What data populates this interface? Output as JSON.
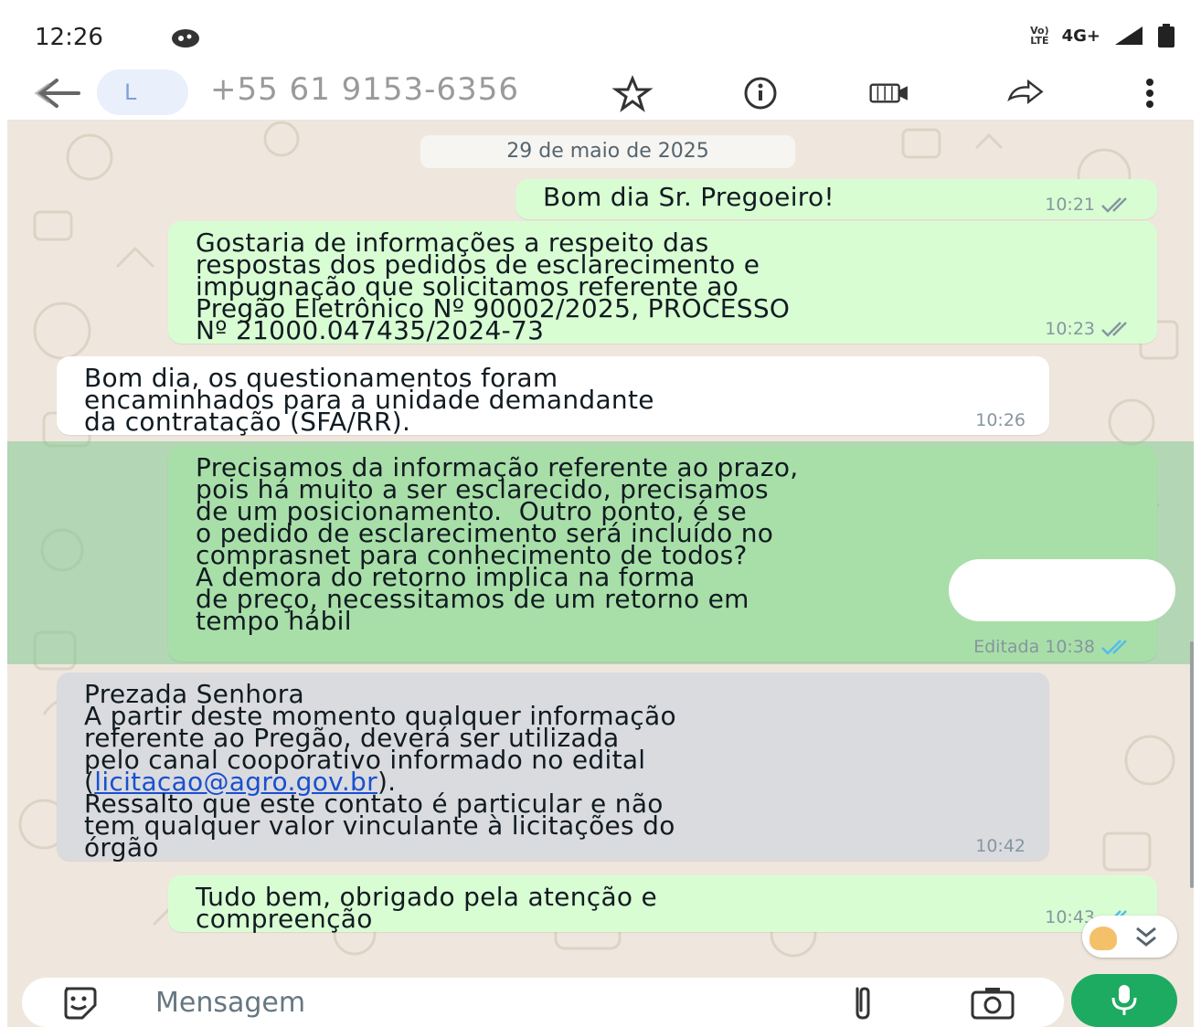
{
  "status_bar": {
    "time": "12:26",
    "volte_label": "Vo)\nLTE",
    "network": "4G+",
    "icons": [
      "app-notification-icon",
      "volte-icon",
      "signal-icon",
      "battery-icon"
    ]
  },
  "header": {
    "avatar_initial": "L",
    "contact": "+55 61 9153-6356",
    "icons": [
      "back-arrow-icon",
      "star-icon",
      "info-icon",
      "video-call-icon",
      "forward-icon",
      "more-icon"
    ]
  },
  "chat": {
    "date_chip": "29 de maio de 2025",
    "messages": [
      {
        "direction": "outgoing",
        "text": "Bom dia Sr. Pregoeiro!",
        "time": "10:21",
        "status": "read"
      },
      {
        "direction": "outgoing",
        "text": "Gostaria de informações a respeito das\nrespostas dos pedidos de esclarecimento e\nimpugnação que solicitamos referente ao\nPregão Eletrônico Nº 90002/2025, PROCESSO\nNº 21000.047435/2024-73",
        "time": "10:23",
        "status": "read"
      },
      {
        "direction": "incoming",
        "text": "Bom dia, os questionamentos foram\nencaminhados para a unidade demandante\nda contratação (SFA/RR).",
        "time": "10:26"
      },
      {
        "direction": "outgoing",
        "selected": true,
        "text_part1": "Precisamos da informação referente ao prazo,\npois há muito a ser esclarecido, precisamos\nde um posicionamento.  Outro ponto, é se\no pedido de esclarecimento será incluído no\ncomprasnet para conhecimento de todos?",
        "text_part2": "A demora do retorno implica na forma\nde preço, necessitamos de um retorno em\ntempo hábil",
        "edited_label": "Editada",
        "time": "10:38",
        "status": "read"
      },
      {
        "direction": "incoming",
        "highlighted": true,
        "text_before_link": "Prezada Senhora\nA partir deste momento qualquer informação\nreferente ao Pregão, deverá ser utilizada\npelo canal cooporativo informado no edital\n(",
        "link": "licitacao@agro.gov.br",
        "text_after_link": ").",
        "text_end": "Ressalto que este contato é particular e não\ntem qualquer valor vinculante à licitações do\nórgão",
        "time": "10:42"
      },
      {
        "direction": "outgoing",
        "text": "Tudo bem, obrigado pela atenção e\ncompreenção",
        "time": "10:43",
        "status": "read"
      }
    ]
  },
  "composer": {
    "placeholder": "Mensagem",
    "icons": [
      "emoji-sticker-icon",
      "attach-icon",
      "camera-icon",
      "microphone-icon"
    ]
  },
  "colors": {
    "outgoing_bubble": "#d9fdd3",
    "incoming_bubble": "#ffffff",
    "wallpaper": "#efe7dd",
    "selection_overlay": "#82c891",
    "mic_button": "#1daa61",
    "read_tick": "#53bdeb",
    "link": "#1a4fd0"
  }
}
